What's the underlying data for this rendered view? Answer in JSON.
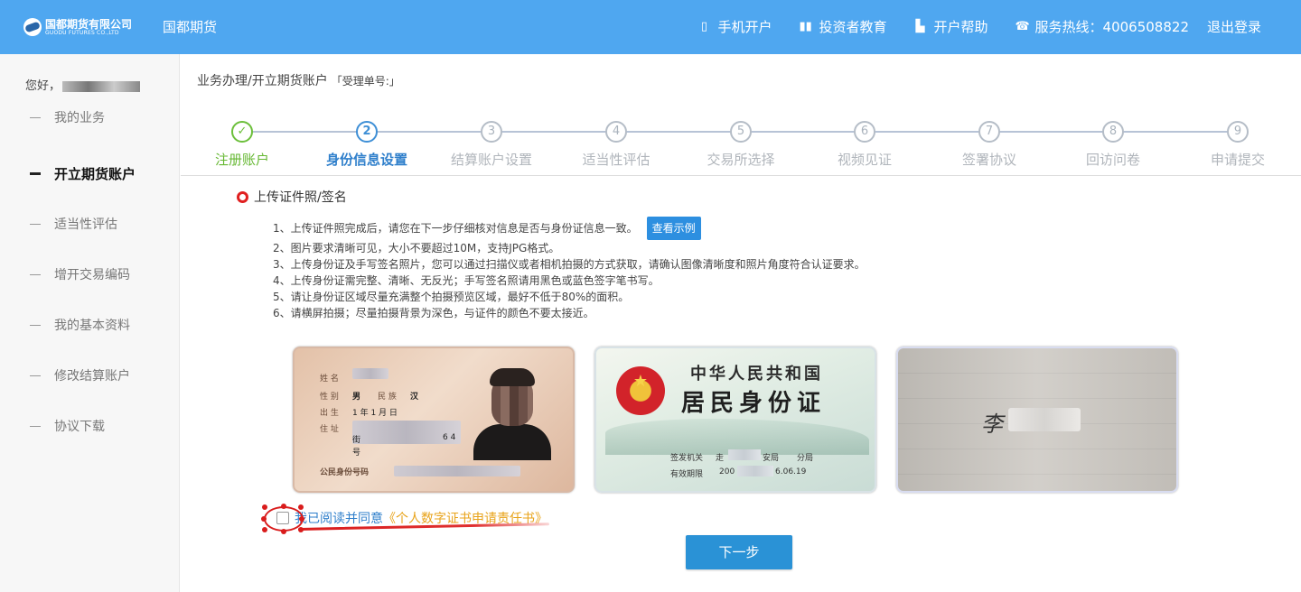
{
  "header": {
    "logo_cn": "国都期货有限公司",
    "logo_en": "GUODU FUTURES CO.,LTD",
    "brand": "国都期货",
    "nav": [
      {
        "icon": "mobile-icon",
        "label": "手机开户"
      },
      {
        "icon": "books-icon",
        "label": "投资者教育"
      },
      {
        "icon": "book-icon",
        "label": "开户帮助"
      }
    ],
    "hotline_label": "服务热线：4006508822",
    "logout": "退出登录"
  },
  "sidebar": {
    "greeting": "您好，",
    "items": [
      {
        "label": "我的业务",
        "active": false
      },
      {
        "label": "开立期货账户",
        "active": true
      },
      {
        "label": "适当性评估",
        "active": false
      },
      {
        "label": "增开交易编码",
        "active": false
      },
      {
        "label": "我的基本资料",
        "active": false
      },
      {
        "label": "修改结算账户",
        "active": false
      },
      {
        "label": "协议下载",
        "active": false
      }
    ]
  },
  "breadcrumb": {
    "path": "业务办理/开立期货账户",
    "order": "「受理单号:」"
  },
  "steps": [
    {
      "num": "✓",
      "label": "注册账户",
      "state": "done"
    },
    {
      "num": "2",
      "label": "身份信息设置",
      "state": "current"
    },
    {
      "num": "3",
      "label": "结算账户设置",
      "state": "todo"
    },
    {
      "num": "4",
      "label": "适当性评估",
      "state": "todo"
    },
    {
      "num": "5",
      "label": "交易所选择",
      "state": "todo"
    },
    {
      "num": "6",
      "label": "视频见证",
      "state": "todo"
    },
    {
      "num": "7",
      "label": "签署协议",
      "state": "todo"
    },
    {
      "num": "8",
      "label": "回访问卷",
      "state": "todo"
    },
    {
      "num": "9",
      "label": "申请提交",
      "state": "todo"
    }
  ],
  "section": {
    "title": "上传证件照/签名",
    "rules": [
      "1、上传证件照完成后，请您在下一步仔细核对信息是否与身份证信息一致。",
      "2、图片要求清晰可见，大小不要超过10M，支持JPG格式。",
      "3、上传身份证及手写签名照片，您可以通过扫描仪或者相机拍摄的方式获取，请确认图像清晰度和照片角度符合认证要求。",
      "4、上传身份证需完整、清晰、无反光；手写签名照请用黑色或蓝色签字笔书写。",
      "5、请让身份证区域尽量充满整个拍摄预览区域，最好不低于80%的面积。",
      "6、请横屏拍摄；尽量拍摄背景为深色，与证件的颜色不要太接近。"
    ],
    "example_button": "查看示例"
  },
  "id_front": {
    "name_label": "姓 名",
    "sex_label": "性 别",
    "sex_value": "男",
    "ethnic_label": "民 族",
    "ethnic_value": "汉",
    "birth_label": "出 生",
    "birth_value": "1   年  1 月  日",
    "addr_label": "住 址",
    "addr_line2": "街",
    "addr_line2_tail": "6 4",
    "addr_line3": "号",
    "id_label": "公民身份号码"
  },
  "id_back": {
    "title1": "中华人民共和国",
    "title2": "居民身份证",
    "authority_label": "签发机关",
    "authority_value_head": "走",
    "authority_value_tail": "安局",
    "authority_value_end": "分局",
    "valid_label": "有效期限",
    "valid_value_head": "200",
    "valid_value_tail": "6.06.19"
  },
  "signature": {
    "strokes": "李"
  },
  "agreement": {
    "text": "我已阅读并同意",
    "doc": "《个人数字证书申请责任书》",
    "checked": false
  },
  "next_button": "下一步",
  "colors": {
    "header_bg": "#4fa7f0",
    "done": "#66b833",
    "current": "#2f7fcb",
    "primary_button": "#2a92d6",
    "doc_link": "#e8a31a",
    "annotation": "#d91c1c"
  }
}
